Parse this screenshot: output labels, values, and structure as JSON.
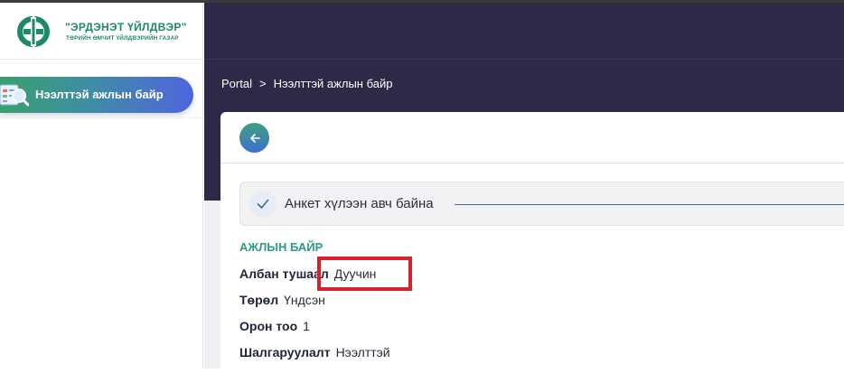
{
  "logo": {
    "title": "\"ЭРДЭНЭТ ҮЙЛДВЭР\"",
    "subtitle": "ТӨРИЙН ӨМЧИТ ҮЙЛДВЭРИЙН ГАЗАР",
    "brand_color": "#1d8a63"
  },
  "sidebar": {
    "items": [
      {
        "label": "Нээлттэй ажлын байр",
        "icon": "job-listing-icon",
        "active": true
      }
    ]
  },
  "breadcrumb": {
    "root": "Portal",
    "separator": ">",
    "current": "Нээлттэй ажлын байр"
  },
  "status": {
    "text": "Анкет хүлээн авч байна",
    "icon": "check-icon"
  },
  "job": {
    "section_title": "АЖЛЫН БАЙР",
    "fields": [
      {
        "label": "Албан тушаал",
        "value": "Дуучин"
      },
      {
        "label": "Төрөл",
        "value": "Үндсэн"
      },
      {
        "label": "Орон тоо",
        "value": "1"
      },
      {
        "label": "Шалгаруулалт",
        "value": "Нээлттэй"
      }
    ]
  },
  "colors": {
    "header": "#2d2947",
    "accent_teal": "#2f9a86",
    "highlight_red": "#d6222a"
  }
}
